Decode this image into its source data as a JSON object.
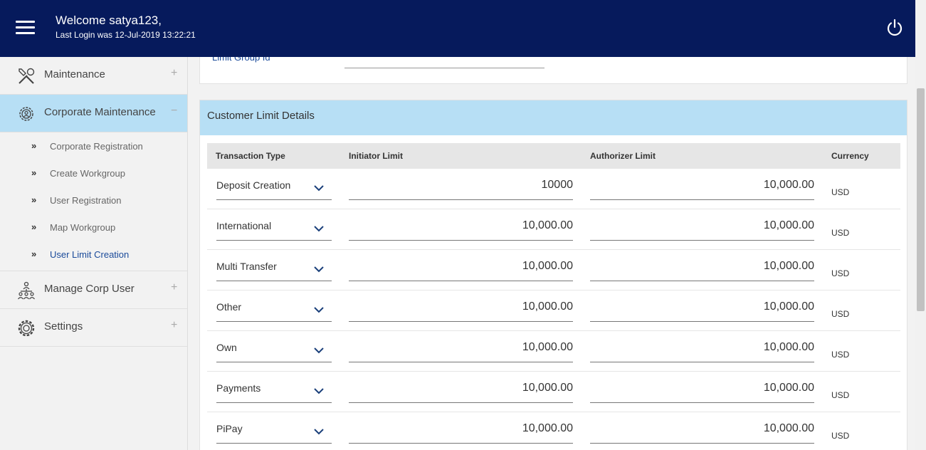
{
  "header": {
    "welcome": "Welcome satya123,",
    "last_login": "Last Login was 12-Jul-2019 13:22:21",
    "bg_color": "#061a5c"
  },
  "sidebar": {
    "items": [
      {
        "label": "Maintenance",
        "icon": "tools-icon",
        "toggle": "+"
      },
      {
        "label": "Corporate Maintenance",
        "icon": "gear-person-icon",
        "toggle": "−"
      },
      {
        "label": "Manage Corp User",
        "icon": "org-chart-icon",
        "toggle": "+"
      },
      {
        "label": "Settings",
        "icon": "gear-icon",
        "toggle": "+"
      }
    ],
    "sub_items": [
      {
        "label": "Corporate Registration"
      },
      {
        "label": "Create Workgroup"
      },
      {
        "label": "User Registration"
      },
      {
        "label": "Map Workgroup"
      },
      {
        "label": "User Limit Creation"
      }
    ],
    "active_color": "#b7dff5"
  },
  "top_card": {
    "field_label": "Limit Group Id"
  },
  "limits": {
    "title": "Customer Limit Details",
    "columns": {
      "type": "Transaction Type",
      "initiator": "Initiator Limit",
      "authorizer": "Authorizer Limit",
      "currency": "Currency"
    },
    "rows": [
      {
        "type": "Deposit Creation",
        "initiator": "10000",
        "authorizer": "10,000.00",
        "currency": "USD"
      },
      {
        "type": "International",
        "initiator": "10,000.00",
        "authorizer": "10,000.00",
        "currency": "USD"
      },
      {
        "type": "Multi Transfer",
        "initiator": "10,000.00",
        "authorizer": "10,000.00",
        "currency": "USD"
      },
      {
        "type": "Other",
        "initiator": "10,000.00",
        "authorizer": "10,000.00",
        "currency": "USD"
      },
      {
        "type": "Own",
        "initiator": "10,000.00",
        "authorizer": "10,000.00",
        "currency": "USD"
      },
      {
        "type": "Payments",
        "initiator": "10,000.00",
        "authorizer": "10,000.00",
        "currency": "USD"
      },
      {
        "type": "PiPay",
        "initiator": "10,000.00",
        "authorizer": "10,000.00",
        "currency": "USD"
      }
    ]
  }
}
